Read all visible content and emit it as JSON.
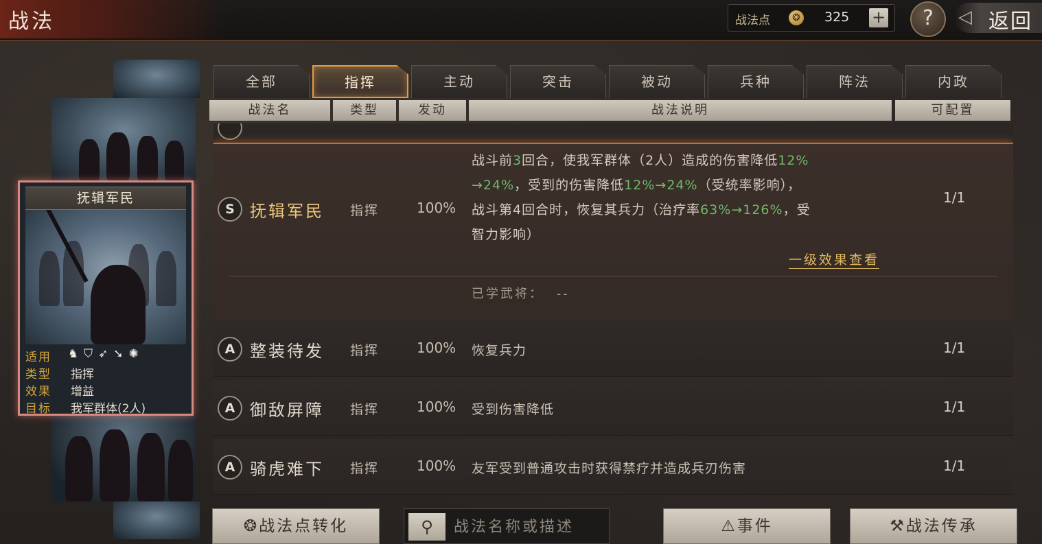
{
  "header": {
    "title": "战法",
    "points_label": "战法点",
    "points_value": "325",
    "plus_symbol": "+",
    "help_symbol": "?",
    "back_label": "返回"
  },
  "tabs": [
    "全部",
    "指挥",
    "主动",
    "突击",
    "被动",
    "兵种",
    "阵法",
    "内政"
  ],
  "active_tab": "指挥",
  "columns": {
    "name": "战法名",
    "type": "类型",
    "trigger": "发动",
    "description": "战法说明",
    "config": "可配置"
  },
  "card": {
    "name": "抚辑军民",
    "rows": [
      {
        "key": "适用",
        "value": ""
      },
      {
        "key": "类型",
        "value": "指挥"
      },
      {
        "key": "效果",
        "value": "增益"
      },
      {
        "key": "目标",
        "value": "我军群体(2人)"
      }
    ],
    "troop_icons": [
      "cavalry-icon",
      "shield-icon",
      "bow-icon",
      "spear-icon",
      "siege-icon"
    ]
  },
  "selected_skill": {
    "grade": "S",
    "name": "抚辑军民",
    "type": "指挥",
    "rate": "100%",
    "config": "1/1",
    "desc_lines": [
      [
        "战斗前",
        "3",
        "回合，使我军群体（2人）造成的伤害降低",
        "12%"
      ],
      [
        "→24%",
        "，受到的伤害降低",
        "12%→24%",
        "（受统率影响），"
      ],
      [
        "战斗第4回合时，恢复其兵力（治疗率",
        "63%→126%",
        "，受"
      ],
      [
        "智力影响）"
      ]
    ],
    "detail_link": "一级效果查看",
    "learned_label": "已学武将：",
    "learned_value": "--"
  },
  "skills": [
    {
      "grade": "A",
      "name": "整装待发",
      "type": "指挥",
      "rate": "100%",
      "desc": "恢复兵力",
      "config": "1/1"
    },
    {
      "grade": "A",
      "name": "御敌屏障",
      "type": "指挥",
      "rate": "100%",
      "desc": "受到伤害降低",
      "config": "1/1"
    },
    {
      "grade": "A",
      "name": "骑虎难下",
      "type": "指挥",
      "rate": "100%",
      "desc": "友军受到普通攻击时获得禁疗并造成兵刃伤害",
      "config": "1/1"
    }
  ],
  "bottom": {
    "convert_label": "战法点转化",
    "search_placeholder": "战法名称或描述",
    "events_label": "事件",
    "inherit_label": "战法传承"
  },
  "colors": {
    "accent_orange": "#e39a45",
    "highlight_green": "#6fb86b",
    "gold": "#e0b860",
    "card_border": "#d88a80"
  }
}
